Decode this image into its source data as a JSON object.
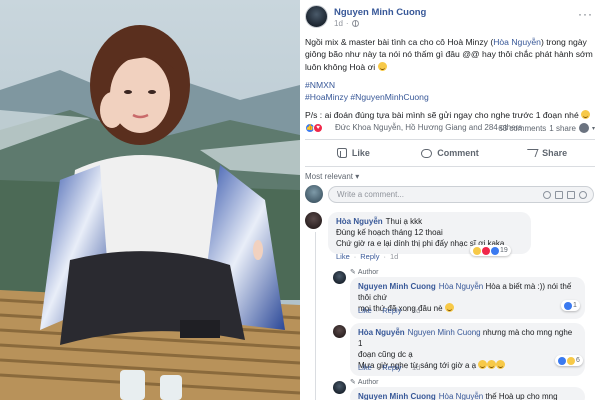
{
  "post": {
    "author": "Nguyen Minh Cuong",
    "time": "1d",
    "more": "···",
    "body_p1_a": "Ngồi mix & master bài tình ca cho cô Hoà Minzy (",
    "body_p1_link": "Hòa Nguyễn",
    "body_p1_b": ") trong ngày giông bão như này ta nói nó thấm gì đâu @@ hay thôi chắc phát hành sớm luôn không Hoà ơi",
    "hashtag1": "#NMXN",
    "hashtag2": "#HoaMinzy #NguyenMinhCuong",
    "body_p3": "P/s : ai đoán đúng tựa bài mình sẽ gửi ngay cho nghe trước 1 đoạn nhé",
    "reactions_text": "Đức Khoa Nguyễn, Hồ Hương Giang and 284 others",
    "comments_count": "63 comments",
    "shares_count": "1 share"
  },
  "actions": {
    "like": "Like",
    "comment": "Comment",
    "share": "Share"
  },
  "filter": {
    "label": "Most relevant",
    "caret": "▾"
  },
  "composer": {
    "placeholder": "Write a comment..."
  },
  "comments": [
    {
      "name": "Hòa Nguyễn",
      "text_inline": "Thui ạ kkk",
      "text_line2": "Đùng kế hoạch tháng 12 thoai",
      "text_line3": "Chứ giờ ra e lại dính thị phi đấy nhạc sĩ ơi kaka",
      "like": "Like",
      "reply": "Reply",
      "time": "1d",
      "reaction_count": "19"
    }
  ],
  "replies": [
    {
      "badge": "Author",
      "name": "Nguyen Minh Cuong",
      "tag": "Hòa Nguyễn",
      "text_a": " Hòa a biết mà :)) nói thế thôi chứ",
      "text_b": "mọi thứ đã xong đâu nè",
      "like": "Like",
      "reply": "Reply",
      "time": "1d",
      "reaction_count": "1"
    },
    {
      "name": "Hòa Nguyễn",
      "tag": "Nguyen Minh Cuong",
      "text_a": " nhưng mà cho mng nghe 1",
      "text_b": "đoạn cũng dc ạ",
      "text_c": "Mưa giờ nghe từ sáng tới giờ a ạ",
      "like": "Like",
      "reply": "Reply",
      "time": "1d",
      "reaction_count": "6"
    },
    {
      "badge": "Author",
      "name": "Nguyen Minh Cuong",
      "tag": "Hòa Nguyễn",
      "text_a": " thế Hoà up cho mng nghe"
    }
  ],
  "colors": {
    "link": "#385898",
    "like_blue": "#3b7af0",
    "love_red": "#f0284a",
    "haha_yellow": "#f7c948",
    "bubble_bg": "#f2f3f5"
  }
}
